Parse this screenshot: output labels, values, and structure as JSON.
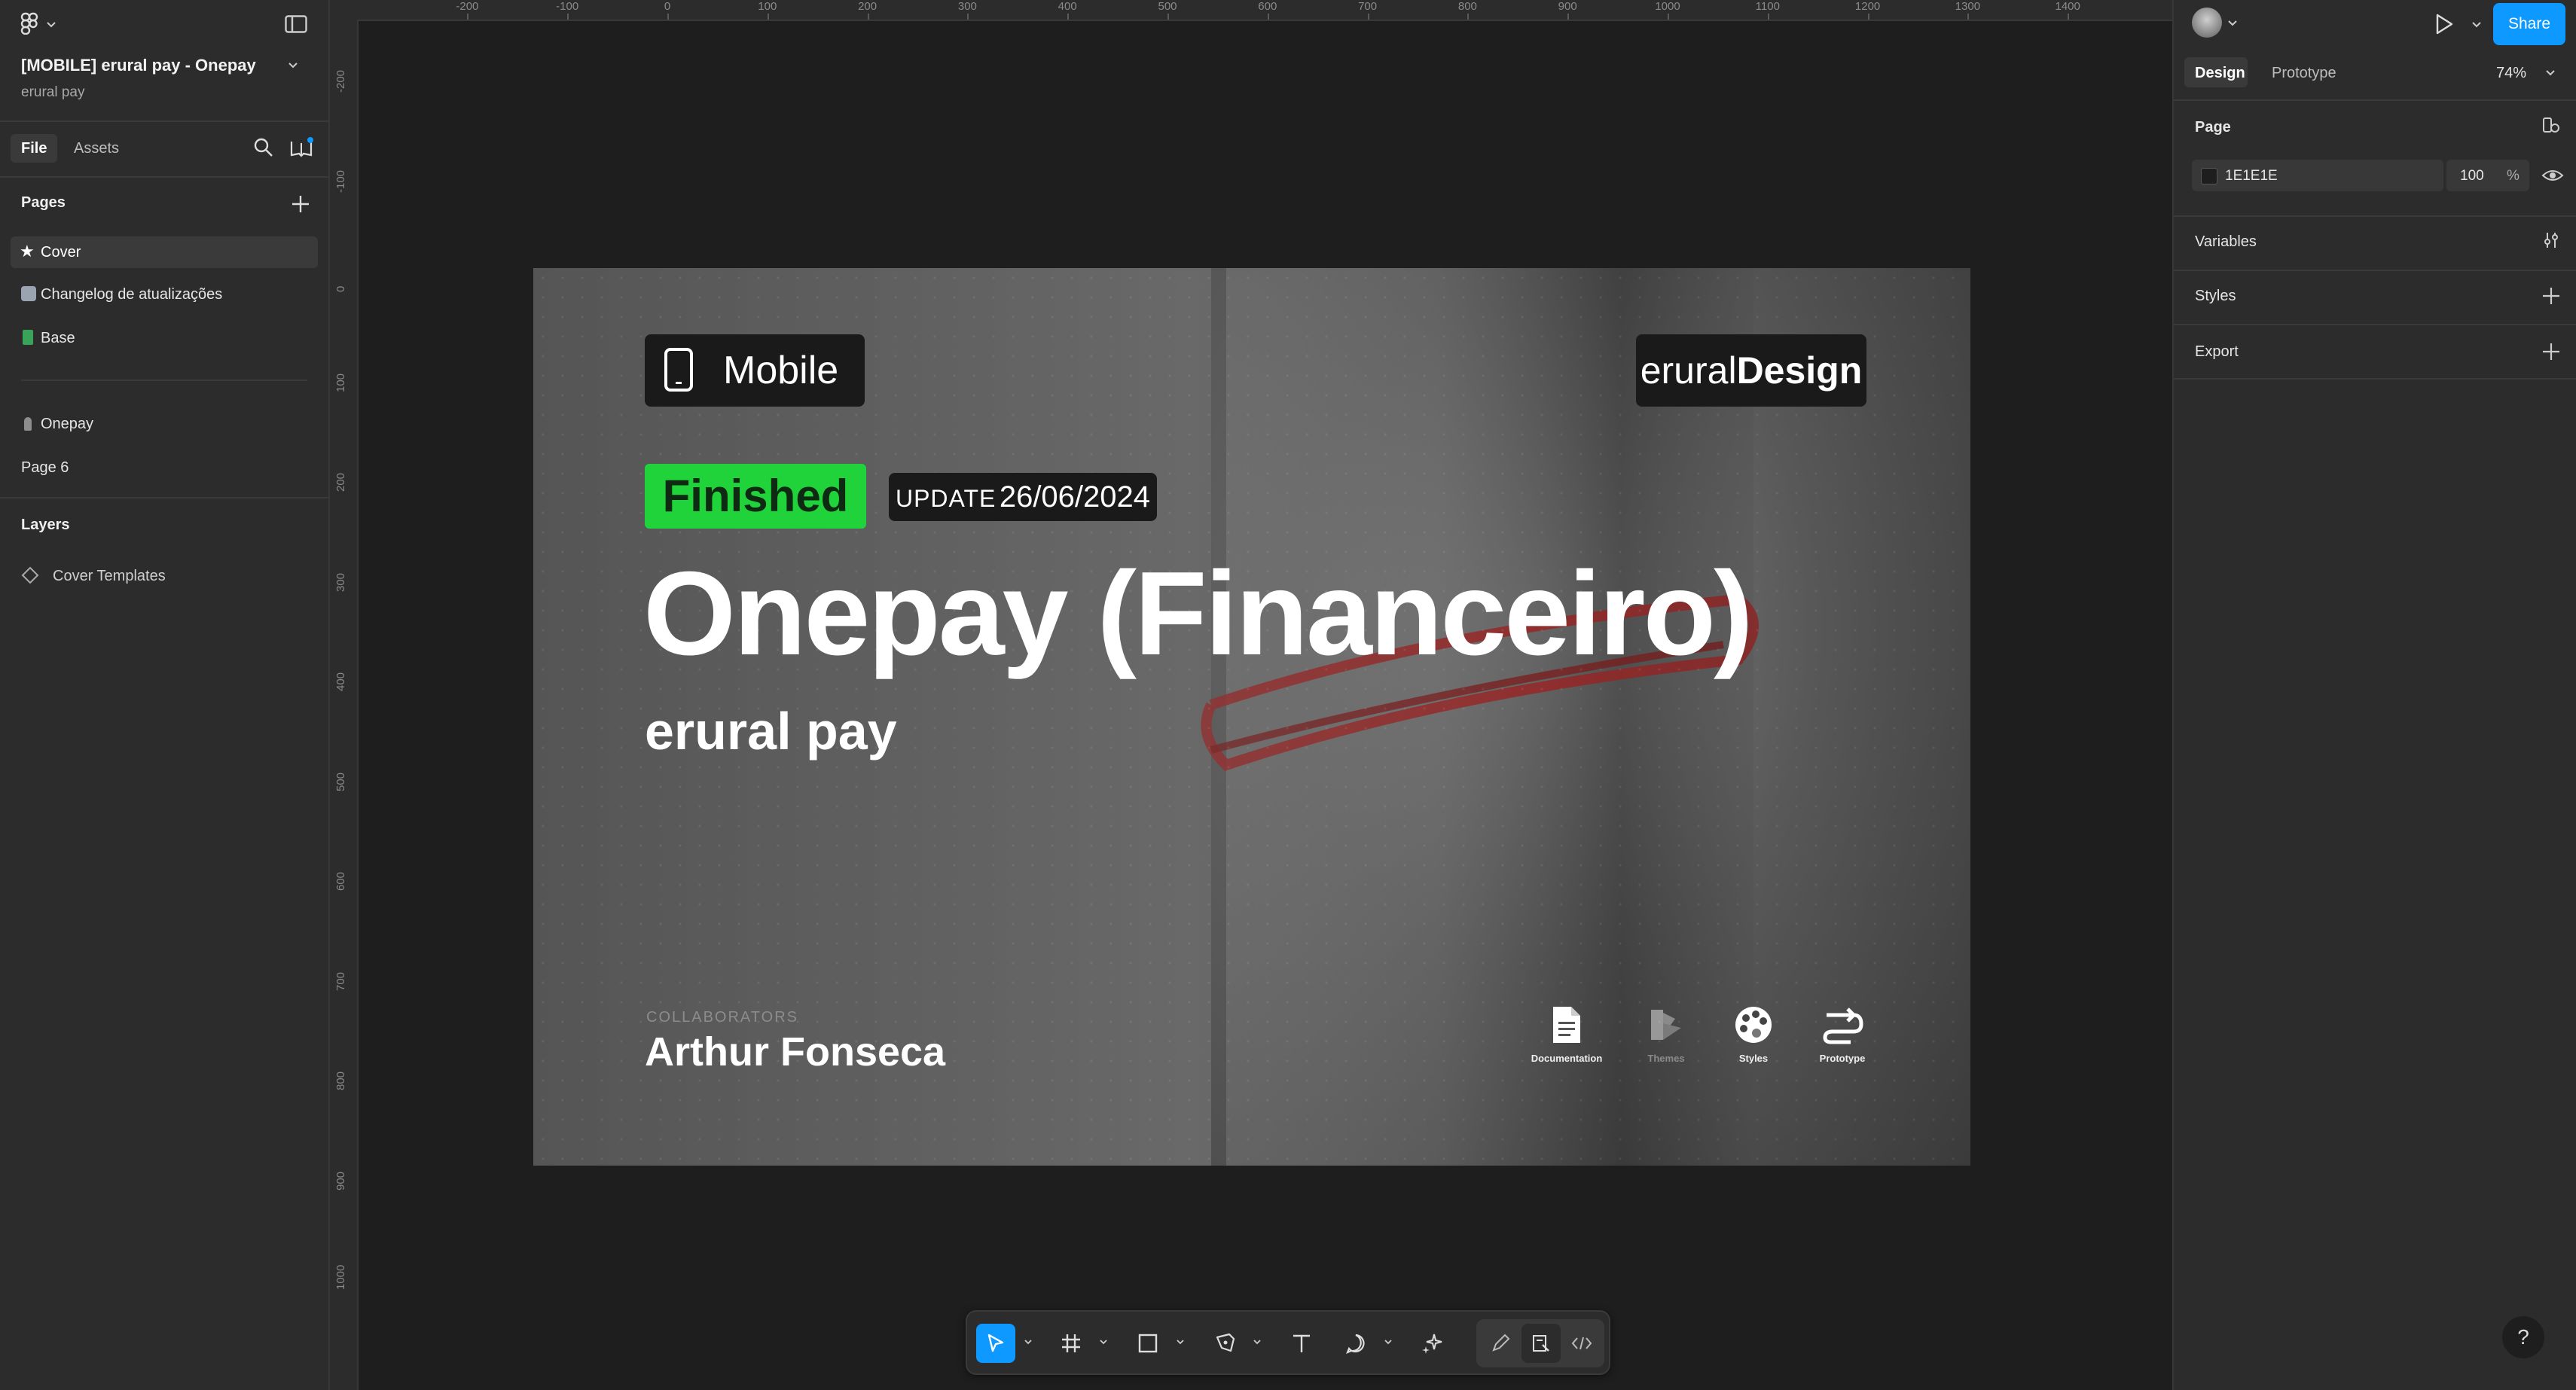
{
  "file": {
    "title": "[MOBILE] erural pay - Onepay",
    "subtitle": "erural pay"
  },
  "left_tabs": {
    "file": "File",
    "assets": "Assets"
  },
  "pages": {
    "title": "Pages",
    "items": [
      {
        "label": "Cover",
        "icon": "star-icon",
        "selected": true
      },
      {
        "label": "Changelog de atualizações",
        "icon": "calendar-icon"
      },
      {
        "label": "Base",
        "icon": "book-icon"
      },
      {
        "label": "Onepay",
        "icon": "person-icon"
      },
      {
        "label": "Page 6",
        "icon": ""
      }
    ]
  },
  "layers": {
    "title": "Layers",
    "items": [
      {
        "label": "Cover Templates",
        "icon": "component-diamond-icon"
      }
    ]
  },
  "ruler": {
    "h_ticks": [
      "-200",
      "-100",
      "0",
      "100",
      "200",
      "300",
      "400",
      "500",
      "600",
      "700",
      "800",
      "900",
      "1000",
      "1100",
      "1200",
      "1300",
      "1400"
    ],
    "v_ticks": [
      "-200",
      "-100",
      "0",
      "100",
      "200",
      "300",
      "400",
      "500",
      "600",
      "700",
      "800",
      "900",
      "1000"
    ]
  },
  "right": {
    "tab_design": "Design",
    "tab_prototype": "Prototype",
    "zoom": "74%",
    "share": "Share",
    "page_label": "Page",
    "page_color": "1E1E1E",
    "page_opacity": "100",
    "percent": "%",
    "variables": "Variables",
    "styles": "Styles",
    "export": "Export"
  },
  "cover": {
    "mobile_badge": "Mobile",
    "brand_light": "erural",
    "brand_bold": "Design",
    "status": "Finished",
    "update_label": "UPDATE",
    "update_date": "26/06/2024",
    "title": "Onepay (Financeiro)",
    "subtitle": "erural pay",
    "collab_label": "COLLABORATORS",
    "collab_name": "Arthur Fonseca",
    "links": [
      "Documentation",
      "Themes",
      "Styles",
      "Prototype"
    ]
  },
  "help": "?",
  "colors": {
    "accent": "#0d99ff",
    "finished": "#20d33a",
    "canvas": "#1e1e1e",
    "panel": "#2c2c2c"
  }
}
